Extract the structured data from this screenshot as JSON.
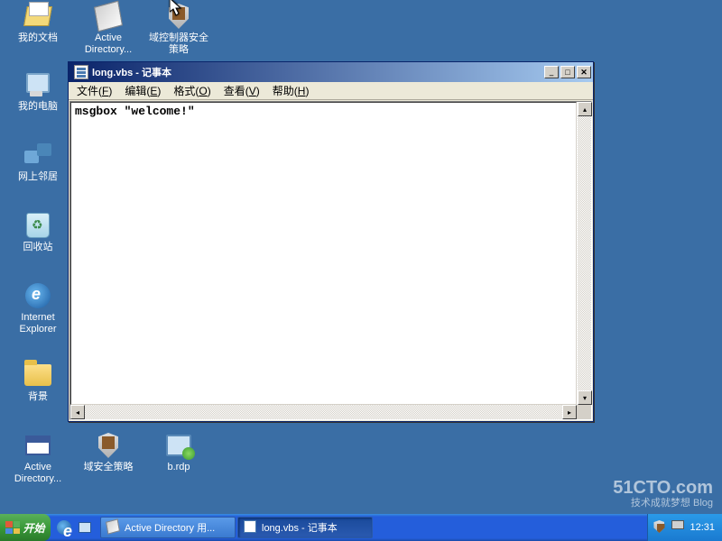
{
  "desktop_icons": [
    {
      "id": "my-documents",
      "label": "我的文档"
    },
    {
      "id": "active-directory-1",
      "label": "Active Directory..."
    },
    {
      "id": "domain-controller-policy",
      "label": "域控制器安全策略"
    },
    {
      "id": "my-computer",
      "label": "我的电脑"
    },
    {
      "id": "network-neighborhood",
      "label": "网上邻居"
    },
    {
      "id": "recycle-bin",
      "label": "回收站"
    },
    {
      "id": "internet-explorer",
      "label": "Internet Explorer"
    },
    {
      "id": "background",
      "label": "背景"
    },
    {
      "id": "active-directory-2",
      "label": "Active Directory..."
    },
    {
      "id": "domain-security-policy",
      "label": "域安全策略"
    },
    {
      "id": "b-rdp",
      "label": "b.rdp"
    }
  ],
  "notepad": {
    "title": "long.vbs - 记事本",
    "menu": [
      {
        "label": "文件",
        "accel": "F"
      },
      {
        "label": "编辑",
        "accel": "E"
      },
      {
        "label": "格式",
        "accel": "O"
      },
      {
        "label": "查看",
        "accel": "V"
      },
      {
        "label": "帮助",
        "accel": "H"
      }
    ],
    "content": "msgbox \"welcome!\"",
    "buttons": {
      "min": "_",
      "max": "□",
      "close": "✕"
    }
  },
  "taskbar": {
    "start_label": "开始",
    "tasks": [
      {
        "id": "ad-users",
        "label": "Active Directory 用...",
        "active": false
      },
      {
        "id": "notepad",
        "label": "long.vbs - 记事本",
        "active": true
      }
    ],
    "clock": "12:31"
  },
  "watermark": {
    "main": "51CTO.com",
    "sub": "技术成就梦想 Blog"
  }
}
